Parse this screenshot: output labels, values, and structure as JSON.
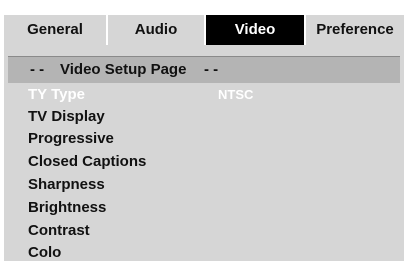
{
  "tabs": [
    {
      "label": "General"
    },
    {
      "label": "Audio"
    },
    {
      "label": "Video"
    },
    {
      "label": "Preference"
    }
  ],
  "header": {
    "left_dashes": "- -",
    "title": "Video Setup Page",
    "right_dashes": "- -"
  },
  "items": [
    {
      "label": "TY Type",
      "value": "NTSC"
    },
    {
      "label": "TV Display"
    },
    {
      "label": "Progressive"
    },
    {
      "label": "Closed Captions"
    },
    {
      "label": "Sharpness"
    },
    {
      "label": "Brightness"
    },
    {
      "label": "Contrast"
    },
    {
      "label": "Colo"
    }
  ],
  "colors": {
    "active_tab_bg": "#000000",
    "panel_bg": "#d6d6d6",
    "header_bg": "#b4b4b4",
    "selected_text": "#ffffff"
  }
}
